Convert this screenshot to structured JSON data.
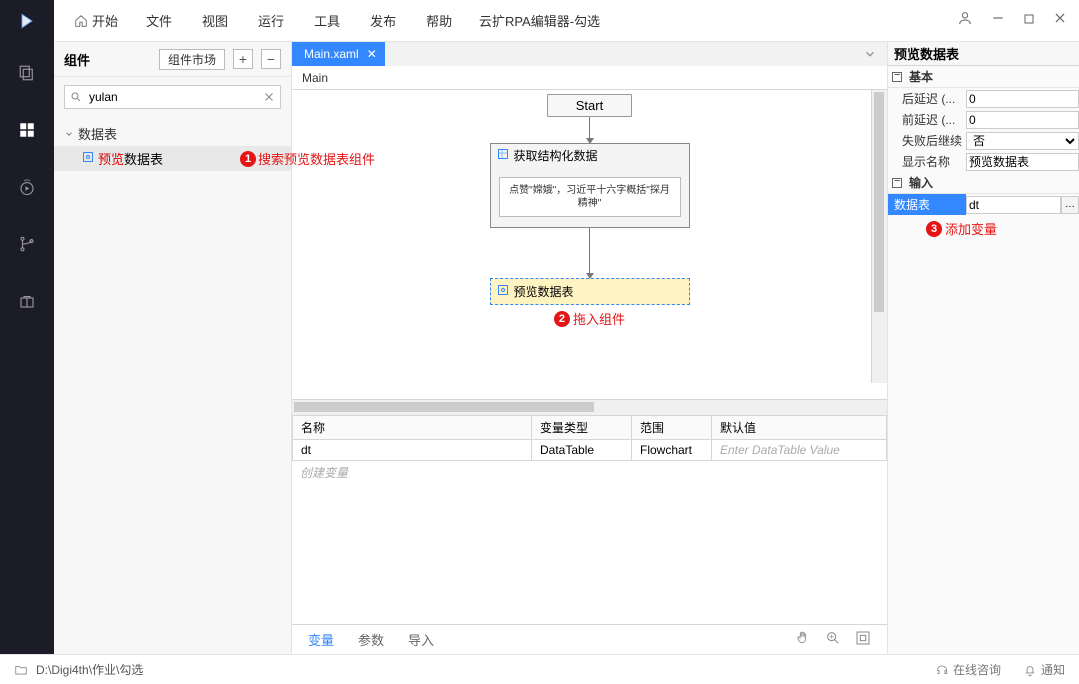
{
  "app": {
    "title": "云扩RPA编辑器-勾选"
  },
  "menus": {
    "home": "开始",
    "items": [
      "文件",
      "视图",
      "运行",
      "工具",
      "发布",
      "帮助"
    ]
  },
  "componentPanel": {
    "title": "组件",
    "marketBtn": "组件市场",
    "searchValue": "yulan",
    "tree": {
      "node": "数据表",
      "leaf_prefix": "预览",
      "leaf_suffix": "数据表"
    }
  },
  "annotations": {
    "a1": "搜索预览数据表组件",
    "a2": "拖入组件",
    "a3": "添加变量"
  },
  "tab": {
    "name": "Main.xaml"
  },
  "breadcrumb": "Main",
  "flow": {
    "start": "Start",
    "activity1": {
      "title": "获取结构化数据",
      "body": "点赞\"嫦娥\"，习近平十六字概括\"探月精神\""
    },
    "activity2": {
      "title": "预览数据表"
    }
  },
  "vars": {
    "headers": [
      "名称",
      "变量类型",
      "范围",
      "默认值"
    ],
    "row": {
      "name": "dt",
      "type": "DataTable",
      "scope": "Flowchart",
      "defPlaceholder": "Enter DataTable Value"
    },
    "create": "创建变量",
    "tabs": [
      "变量",
      "参数",
      "导入"
    ]
  },
  "props": {
    "title": "预览数据表",
    "group1": "基本",
    "rows1": [
      {
        "label": "后延迟 (...",
        "value": "0"
      },
      {
        "label": "前延迟 (...",
        "value": "0"
      },
      {
        "label": "失败后继续",
        "value": "否",
        "isSelect": true
      },
      {
        "label": "显示名称",
        "value": "预览数据表"
      }
    ],
    "group2": "输入",
    "row_input": {
      "label": "数据表",
      "value": "dt"
    }
  },
  "statusbar": {
    "path": "D:\\Digi4th\\作业\\勾选",
    "help": "在线咨询",
    "notify": "通知"
  }
}
